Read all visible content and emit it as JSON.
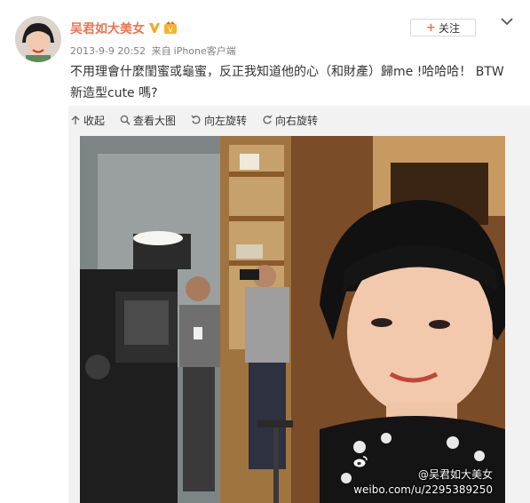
{
  "post": {
    "username": "吴君如大美女",
    "timestamp": "2013-9-9 20:52",
    "source_prefix": "来自",
    "source": "iPhone客户端",
    "follow_label": "关注",
    "text": "不用理會什麼閨蜜或龜蜜，反正我知道他的心（和財產）歸me !哈哈哈！ BTW 新造型cute 嗎?"
  },
  "toolbar": {
    "collapse_label": "收起",
    "view_large_label": "查看大图",
    "rotate_left_label": "向左旋转",
    "rotate_right_label": "向右旋转"
  },
  "watermark": {
    "handle": "@吴君如大美女",
    "url": "weibo.com/u/2295389250"
  },
  "colors": {
    "username": "#eb7350",
    "accent": "#eb7350",
    "verified": "#f5a623",
    "panel_bg": "#f2f2f2"
  }
}
